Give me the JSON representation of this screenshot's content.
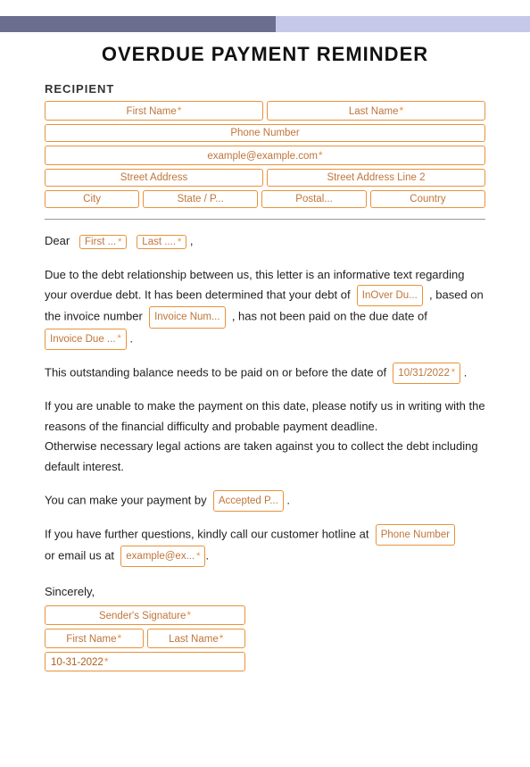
{
  "header": {
    "title": "OVERDUE PAYMENT REMINDER"
  },
  "recipient": {
    "label": "RECIPIENT",
    "first_name": {
      "placeholder": "First Name",
      "required": true
    },
    "last_name": {
      "placeholder": "Last Name",
      "required": true
    },
    "phone": {
      "placeholder": "Phone Number",
      "required": false
    },
    "email": {
      "placeholder": "example@example.com",
      "required": true
    },
    "street1": {
      "placeholder": "Street Address",
      "required": false
    },
    "street2": {
      "placeholder": "Street Address Line 2",
      "required": false
    },
    "city": {
      "placeholder": "City",
      "required": false
    },
    "state": {
      "placeholder": "State / P...",
      "required": false
    },
    "postal": {
      "placeholder": "Postal...",
      "required": false
    },
    "country": {
      "placeholder": "Country",
      "required": false
    }
  },
  "dear_line": {
    "prefix": "Dear",
    "first": {
      "text": "First ...",
      "required": true
    },
    "last": {
      "text": "Last ....",
      "required": true
    },
    "suffix": ","
  },
  "body": {
    "para1_before": "Due to the debt relationship between us, this letter is an informative text regarding your overdue debt. It has been determined that your debt of",
    "amount_field": {
      "text": "InOver Du...",
      "required": false
    },
    "para1_mid": ", based on the invoice number",
    "invoice_num_field": {
      "text": "Invoice Num...",
      "required": false
    },
    "para1_end": ", has not been paid on the due date of",
    "invoice_due_field": {
      "text": "Invoice Due ...",
      "required": true
    },
    "para2_before": "This outstanding balance needs to be paid on or before the date of",
    "pay_by_field": {
      "text": "10/31/2022",
      "required": true
    },
    "para2_end": ".",
    "para3": "If you are unable to make the payment on this date, please notify us in writing with the reasons of the financial difficulty and probable payment deadline.\nOtherwise necessary legal actions are taken against you to collect the debt including default interest.",
    "para4_before": "You can make your payment by",
    "accepted_field": {
      "text": "Accepted P...",
      "required": false
    },
    "para4_end": ".",
    "para5_before": "If you have further questions, kindly call our customer hotline at",
    "hotline_field": {
      "text": "Phone Number",
      "required": false
    },
    "para5_mid": "or email us at",
    "email_field": {
      "text": "example@ex...",
      "required": true
    },
    "para5_end": "."
  },
  "sincerely": {
    "label": "Sincerely,",
    "signature": {
      "placeholder": "Sender's Signature",
      "required": true
    },
    "first_name": {
      "placeholder": "First Name",
      "required": true
    },
    "last_name": {
      "placeholder": "Last Name",
      "required": true
    },
    "date": {
      "value": "10-31-2022",
      "required": true
    }
  }
}
